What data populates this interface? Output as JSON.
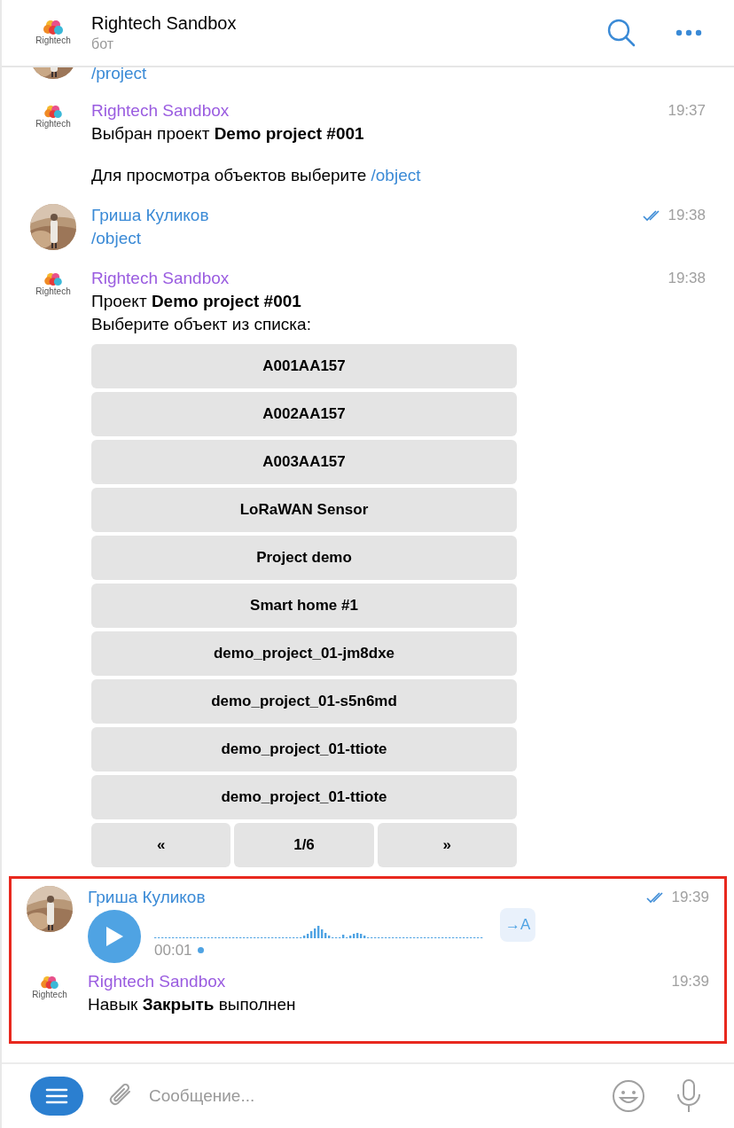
{
  "header": {
    "logo_text": "Rightech",
    "title": "Rightech Sandbox",
    "subtitle": "бот"
  },
  "messages": [
    {
      "kind": "user_partial",
      "lines": [
        {
          "text": "/project",
          "link": true
        }
      ],
      "highlighted": false
    },
    {
      "kind": "bot_text",
      "logo_text": "Rightech",
      "name": "Rightech Sandbox",
      "time": "19:37",
      "highlighted": false,
      "paragraphs": [
        [
          {
            "text": "Выбран проект **Demo project #001**"
          }
        ],
        [
          {
            "text": "Для просмотра объектов выберите ",
            "link_text": "/object"
          }
        ]
      ]
    },
    {
      "kind": "user_text",
      "name": "Гриша Куликов",
      "time": "19:38",
      "read": true,
      "highlighted": false,
      "lines": [
        {
          "text": "/object",
          "link": true
        }
      ]
    },
    {
      "kind": "bot_keyboard",
      "logo_text": "Rightech",
      "name": "Rightech Sandbox",
      "time": "19:38",
      "highlighted": false,
      "lines": [
        {
          "text": "Проект **Demo project #001**"
        },
        {
          "text": "Выберите объект из списка:"
        }
      ],
      "keyboard": [
        [
          "A001AA157"
        ],
        [
          "A002AA157"
        ],
        [
          "A003AA157"
        ],
        [
          "LoRaWAN Sensor"
        ],
        [
          "Project demo"
        ],
        [
          "Smart home #1"
        ],
        [
          "demo_project_01-jm8dxe"
        ],
        [
          "demo_project_01-s5n6md"
        ],
        [
          "demo_project_01-ttiote"
        ],
        [
          "demo_project_01-ttiote"
        ],
        [
          "«",
          "1/6",
          "»"
        ]
      ]
    },
    {
      "kind": "user_voice",
      "name": "Гриша Куликов",
      "time": "19:39",
      "read": true,
      "highlighted": true,
      "duration": "00:01",
      "unlistened": true,
      "transcribe": "→A"
    },
    {
      "kind": "bot_text",
      "logo_text": "Rightech",
      "name": "Rightech Sandbox",
      "time": "19:39",
      "highlighted": true,
      "lines": [
        {
          "text": "Навык **Закрыть** выполнен"
        }
      ]
    }
  ],
  "composer": {
    "placeholder": "Сообщение..."
  }
}
